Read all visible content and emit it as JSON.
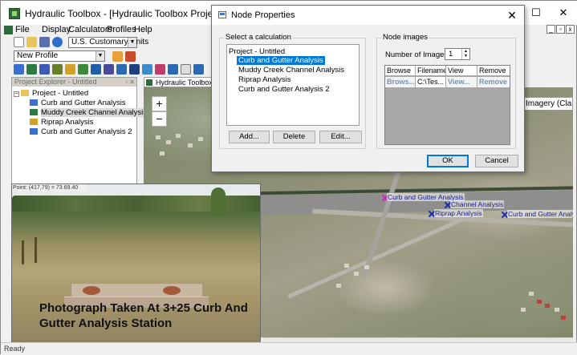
{
  "app": {
    "title": "Hydraulic Toolbox - [Hydraulic Toolbox Project]",
    "window_controls": {
      "minimize": "—",
      "maximize": "☐",
      "close": "✕"
    }
  },
  "menu": {
    "file": "File",
    "display": "Display",
    "calculators": "Calculators",
    "profiles": "Profiles",
    "help": "Help"
  },
  "toolbar": {
    "units_value": "U.S. Customary Units",
    "profile_value": "New Profile"
  },
  "explorer": {
    "title": "Project Explorer - Untitled",
    "pin": "▫ ✕",
    "root": "Project - Untitled",
    "items": [
      {
        "label": "Curb and Gutter Analysis",
        "icon": "curb-gutter-icon"
      },
      {
        "label": "Muddy Creek Channel Analysis",
        "icon": "channel-icon"
      },
      {
        "label": "Riprap Analysis",
        "icon": "riprap-icon"
      },
      {
        "label": "Curb and Gutter Analysis 2",
        "icon": "curb-gutter-icon"
      }
    ]
  },
  "document": {
    "tab_label": "Hydraulic Toolbox Pro",
    "imagery_label": "Imagery (Clarit",
    "zoom_in": "+",
    "zoom_out": "−",
    "map_labels": [
      "Curb and Gutter Analysis",
      "Channel Analysis",
      "Riprap Analysis",
      "Curb and Gutter Analysis"
    ]
  },
  "photo": {
    "coords": "Point: (417,79) = 73.69.40",
    "caption": "Photograph Taken At 3+25 Curb And Gutter Analysis Station"
  },
  "status": {
    "text": "Ready"
  },
  "dialog": {
    "title": "Node Properties",
    "close": "✕",
    "calc_group_title": "Select a calculation",
    "tree_root": "Project - Untitled",
    "tree_items": [
      "Curb and Gutter Analysis",
      "Muddy Creek Channel Analysis",
      "Riprap Analysis",
      "Curb and Gutter Analysis 2"
    ],
    "selected_index": 0,
    "add_label": "Add...",
    "delete_label": "Delete",
    "edit_label": "Edit...",
    "images_group_title": "Node images",
    "num_images_label": "Number of Images:",
    "num_images_value": "1",
    "grid_headers": [
      "Browse",
      "Filename",
      "View",
      "Remove"
    ],
    "grid_row": [
      "Brows...",
      "C:\\Tes...",
      "View...",
      "Remove"
    ],
    "ok_label": "OK",
    "cancel_label": "Cancel"
  }
}
